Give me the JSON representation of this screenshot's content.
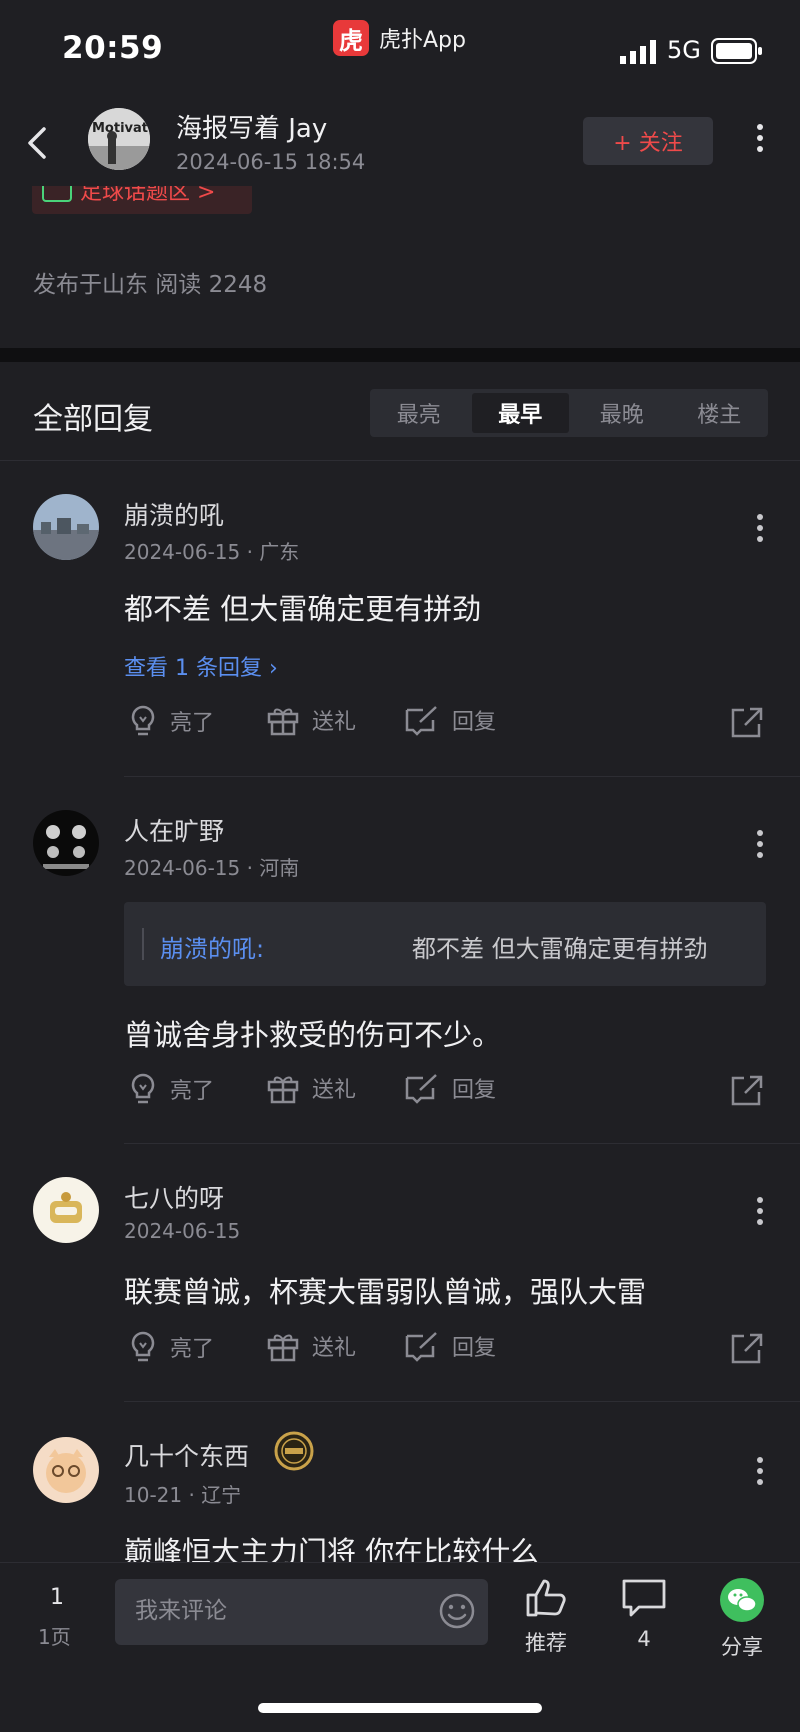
{
  "status_bar": {
    "time": "20:59",
    "app_name": "虎扑App",
    "app_logo_char": "虎",
    "network": "5G"
  },
  "header": {
    "author": "海报写着 Jay",
    "time": "2024-06-15 18:54",
    "follow_label": "+ 关注"
  },
  "post": {
    "tag_label": "足球话题区 >",
    "location_reads": "发布于山东  阅读 2248"
  },
  "replies": {
    "title": "全部回复",
    "sort_options": [
      "最亮",
      "最早",
      "最晚",
      "楼主"
    ],
    "active_sort": "最早"
  },
  "actions": {
    "light": "亮了",
    "gift": "送礼",
    "reply": "回复"
  },
  "comments": [
    {
      "name": "崩溃的吼",
      "meta": "2024-06-15 · 广东",
      "text": "都不差 但大雷确定更有拼劲",
      "replies_link": "查看 1 条回复"
    },
    {
      "name": "人在旷野",
      "meta": "2024-06-15 · 河南",
      "quote_name": "崩溃的吼:",
      "quote_text": "都不差 但大雷确定更有拼劲",
      "text": "曾诚舍身扑救受的伤可不少。"
    },
    {
      "name": "七八的呀",
      "meta": "2024-06-15",
      "text": "联赛曾诚，杯赛大雷弱队曾诚，强队大雷"
    },
    {
      "name": "几十个东西",
      "meta": "10-21 · 辽宁",
      "text": "巅峰恒大主力门将 你在比较什么"
    }
  ],
  "bottom_bar": {
    "page_number": "1",
    "page_label": "1页",
    "comment_placeholder": "我来评论",
    "recommend_label": "推荐",
    "comment_count": "4",
    "share_label": "分享"
  },
  "colors": {
    "accent_red": "#ef4a4a",
    "link_blue": "#5b8ff0",
    "wechat_green": "#3fbf5e",
    "background": "#1f1f23"
  }
}
